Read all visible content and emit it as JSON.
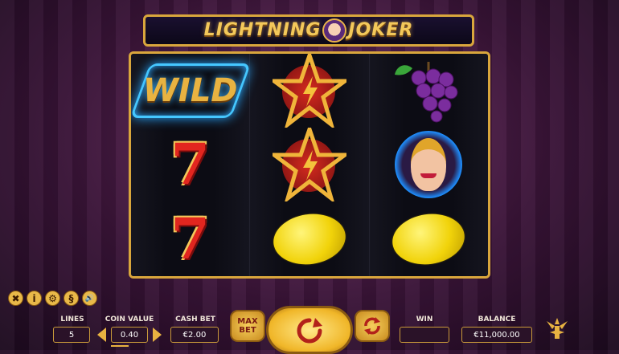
{
  "game": {
    "title_part1": "LIGHTNING",
    "title_part2": "JOKER"
  },
  "reels": [
    [
      "wild",
      "seven",
      "seven"
    ],
    [
      "star",
      "star",
      "lemon"
    ],
    [
      "grapes",
      "joker",
      "lemon"
    ]
  ],
  "symbols": {
    "wild_label": "WILD",
    "seven_label": "7"
  },
  "toolbar": {
    "icons": [
      "close-icon",
      "info-icon",
      "settings-icon",
      "paytable-icon",
      "sound-icon"
    ],
    "close_glyph": "✖",
    "info_glyph": "i",
    "settings_glyph": "⚙",
    "paytable_glyph": "§",
    "sound_glyph": "🔊"
  },
  "bet": {
    "lines_label": "LINES",
    "lines_value": "5",
    "coin_label": "COIN VALUE",
    "coin_value": "0.40",
    "cash_label": "CASH BET",
    "cash_value": "€2.00"
  },
  "buttons": {
    "max_bet": "MAX BET"
  },
  "status": {
    "win_label": "WIN",
    "win_value": "",
    "balance_label": "BALANCE",
    "balance_value": "€11,000.00"
  },
  "colors": {
    "gold": "#d9a63c",
    "frame_bg": "#0a0a12",
    "accent_blue": "#45c7ff"
  }
}
